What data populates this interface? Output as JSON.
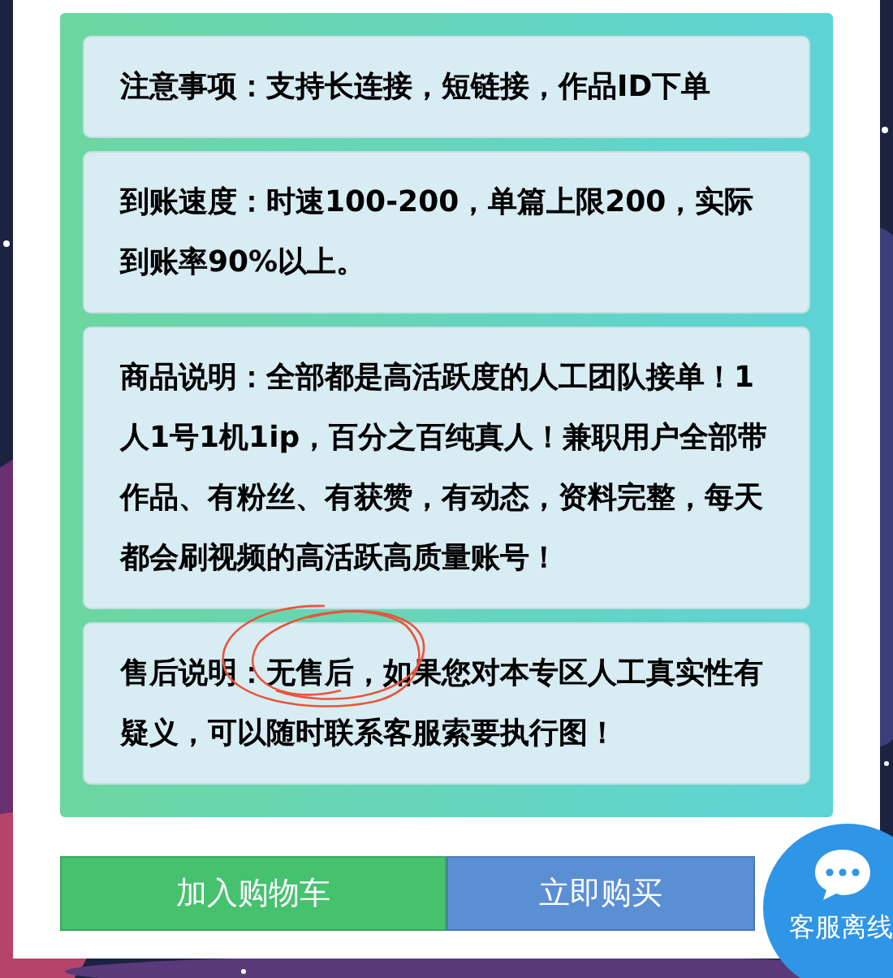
{
  "notices": [
    {
      "text": "注意事项：支持长连接，短链接，作品ID下单"
    },
    {
      "text": "到账速度：时速100-200，单篇上限200，实际到账率90%以上。"
    },
    {
      "text": "商品说明：全部都是高活跃度的人工团队接单！1人1号1机1ip，百分之百纯真人！兼职用户全部带作品、有粉丝、有获赞，有动态，资料完整，每天都会刷视频的高活跃高质量账号！"
    },
    {
      "text": "售后说明：无售后，如果您对本专区人工真实性有疑义，可以随时联系客服索要执行图！"
    }
  ],
  "buttons": [
    {
      "label": "加入购物车",
      "kind": "cart"
    },
    {
      "label": "立即购买",
      "kind": "buy"
    }
  ],
  "chat": {
    "label": "客服离线"
  }
}
